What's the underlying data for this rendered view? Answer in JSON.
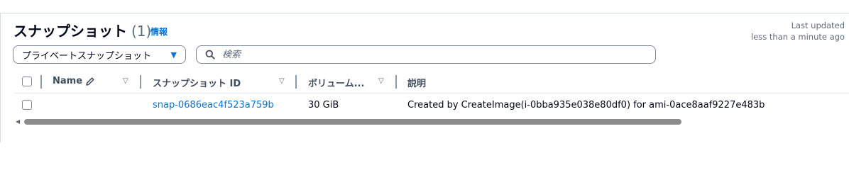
{
  "header": {
    "title": "スナップショット",
    "count": "(1)",
    "info_link": "情報",
    "last_updated_label": "Last updated",
    "last_updated_value": "less than a minute ago"
  },
  "filters": {
    "dropdown_value": "プライベートスナップショット",
    "search_placeholder": "検索"
  },
  "table": {
    "columns": [
      {
        "label": "Name"
      },
      {
        "label": "スナップショット ID"
      },
      {
        "label": "ボリューム..."
      },
      {
        "label": "説明"
      }
    ],
    "rows": [
      {
        "name": "",
        "snapshot_id": "snap-0686eac4f523a759b",
        "volume": "30 GiB",
        "description": "Created by CreateImage(i-0bba935e038e80df0) for ami-0ace8aaf9227e483b"
      }
    ]
  },
  "colors": {
    "link": "#0972d3",
    "text": "#000716",
    "secondary": "#5f6b7a",
    "border": "#7d8998"
  },
  "icons": {
    "name_edit": "pencil-icon",
    "search": "search-icon",
    "dropdown": "caret-down-icon",
    "sort": "sort-caret-icon"
  }
}
